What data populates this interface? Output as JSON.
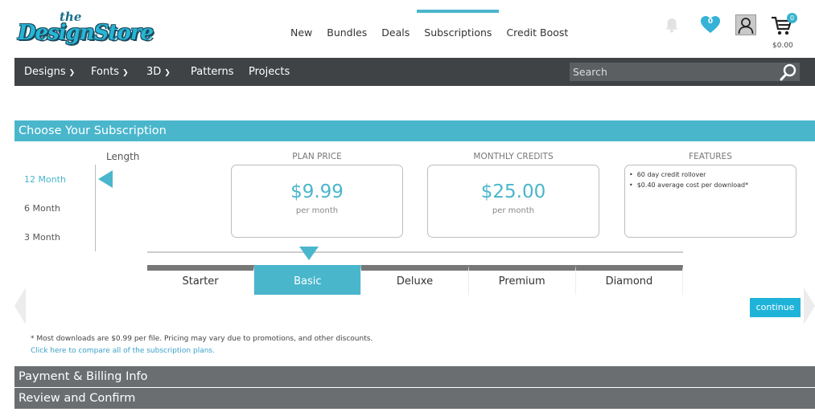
{
  "header": {
    "logo_small": "the",
    "logo_main": "DesignStore",
    "nav": [
      {
        "label": "New"
      },
      {
        "label": "Bundles"
      },
      {
        "label": "Deals"
      },
      {
        "label": "Subscriptions",
        "active": true
      },
      {
        "label": "Credit Boost"
      }
    ],
    "wishlist_count": "0",
    "cart_count": "0",
    "cart_total": "$0.00"
  },
  "main_nav": {
    "items": [
      {
        "label": "Designs",
        "has_dropdown": true
      },
      {
        "label": "Fonts",
        "has_dropdown": true
      },
      {
        "label": "3D",
        "has_dropdown": true
      },
      {
        "label": "Patterns",
        "has_dropdown": false
      },
      {
        "label": "Projects",
        "has_dropdown": false
      }
    ],
    "search_placeholder": "Search"
  },
  "subscription": {
    "section_title": "Choose Your Subscription",
    "length_label": "Length",
    "lengths": [
      {
        "label": "12 Month",
        "active": true
      },
      {
        "label": "6 Month",
        "active": false
      },
      {
        "label": "3 Month",
        "active": false
      }
    ],
    "plan_price_heading": "PLAN PRICE",
    "plan_price": "$9.99",
    "plan_price_period": "per month",
    "monthly_credits_heading": "MONTHLY CREDITS",
    "monthly_credits": "$25.00",
    "monthly_credits_period": "per month",
    "features_heading": "FEATURES",
    "features": [
      "60 day credit rollover",
      "$0.40 average cost per download*"
    ],
    "plans": [
      {
        "label": "Starter",
        "active": false
      },
      {
        "label": "Basic",
        "active": true
      },
      {
        "label": "Deluxe",
        "active": false
      },
      {
        "label": "Premium",
        "active": false
      },
      {
        "label": "Diamond",
        "active": false
      }
    ],
    "continue_label": "continue",
    "note": "* Most downloads are $0.99 per file. Pricing may vary due to promotions, and other discounts.",
    "compare_link": "Click here to compare all of the subscription plans."
  },
  "payment_section_title": "Payment & Billing Info",
  "review_section_title": "Review and Confirm",
  "colors": {
    "accent": "#4ab6cc",
    "nav_dark": "#3f4345",
    "section_gray": "#6b6e70",
    "continue_button": "#1fb3d9"
  }
}
